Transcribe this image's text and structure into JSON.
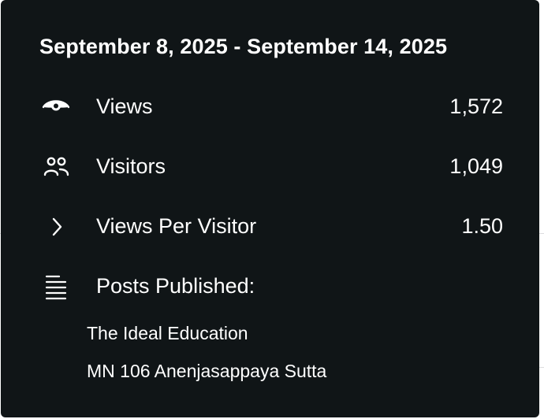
{
  "tooltip": {
    "date_range": "September 8, 2025 - September 14, 2025",
    "stats": [
      {
        "icon": "eye-icon",
        "label": "Views",
        "value": "1,572"
      },
      {
        "icon": "people-icon",
        "label": "Visitors",
        "value": "1,049"
      },
      {
        "icon": "chevron-right-icon",
        "label": "Views Per Visitor",
        "value": "1.50"
      }
    ],
    "posts": {
      "icon": "lines-icon",
      "label": "Posts Published:",
      "items": [
        "The Ideal Education",
        "MN 106 Anenjasappaya Sutta"
      ]
    }
  },
  "colors": {
    "tooltip_background": "#101517",
    "text": "#ffffff",
    "page_background": "#ffffff"
  }
}
